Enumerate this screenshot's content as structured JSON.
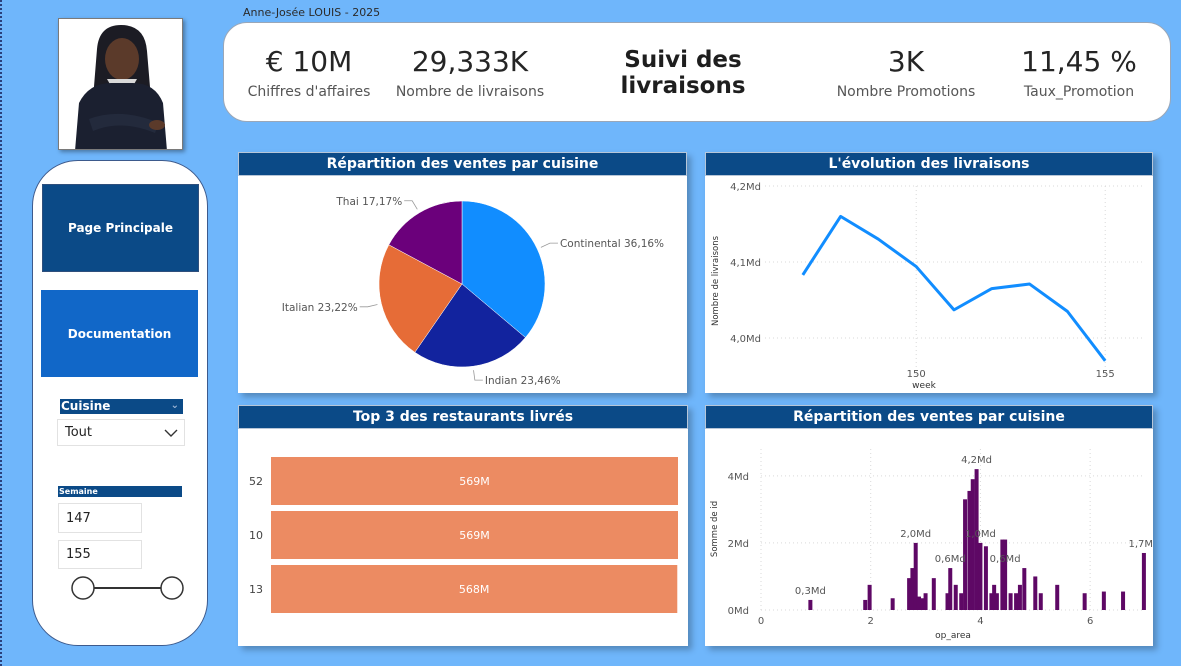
{
  "header": {
    "author": "Anne-Josée LOUIS - 2025",
    "title": "Suivi des livraisons"
  },
  "kpis": [
    {
      "value": "€ 10M",
      "label": "Chiffres d'affaires"
    },
    {
      "value": "29,333K",
      "label": "Nombre de livraisons"
    },
    {
      "value": "3K",
      "label": "Nombre Promotions"
    },
    {
      "value": "11,45 %",
      "label": "Taux_Promotion"
    }
  ],
  "nav": {
    "main_label": "Page Principale",
    "doc_label": "Documentation"
  },
  "filters": {
    "cuisine_label": "Cuisine",
    "cuisine_value": "Tout",
    "semaine_label": "Semaine",
    "semaine_min": "147",
    "semaine_max": "155"
  },
  "colors": {
    "background": "#6fb6fb",
    "title_bar": "#0b4a87",
    "nav_main": "#0b4a87",
    "nav_doc": "#1167c8"
  },
  "chart_data": [
    {
      "type": "pie",
      "title": "Répartition des ventes par cuisine",
      "slices": [
        {
          "label": "Continental",
          "value": 36.16,
          "display": "Continental 36,16%",
          "color": "#118dff"
        },
        {
          "label": "Indian",
          "value": 23.46,
          "display": "Indian 23,46%",
          "color": "#12239e"
        },
        {
          "label": "Italian",
          "value": 23.22,
          "display": "Italian 23,22%",
          "color": "#e66c37"
        },
        {
          "label": "Thai",
          "value": 17.17,
          "display": "Thai 17,17%",
          "color": "#6b007b"
        }
      ]
    },
    {
      "type": "line",
      "title": "L'évolution des livraisons",
      "xlabel": "week",
      "ylabel": "Nombre de livraisons",
      "xlim": [
        146,
        156
      ],
      "ylim": [
        3.95,
        4.2
      ],
      "x": [
        147,
        148,
        149,
        150,
        151,
        152,
        153,
        154,
        155
      ],
      "values": [
        4.083,
        4.16,
        4.13,
        4.094,
        4.037,
        4.065,
        4.071,
        4.035,
        3.97
      ],
      "color": "#118dff",
      "xticks": [
        {
          "v": 150,
          "label": "150"
        },
        {
          "v": 155,
          "label": "155"
        }
      ],
      "yticks": [
        {
          "v": 4.0,
          "label": "4,0Md"
        },
        {
          "v": 4.1,
          "label": "4,1Md"
        },
        {
          "v": 4.2,
          "label": "4,2Md"
        }
      ]
    },
    {
      "type": "bar",
      "orientation": "horizontal",
      "title": "Top 3 des restaurants livrés",
      "categories": [
        "52",
        "10",
        "13"
      ],
      "values": [
        569,
        569,
        568
      ],
      "labels": [
        "569M",
        "569M",
        "568M"
      ],
      "xlim": [
        0,
        569
      ],
      "color": "#ec8b62"
    },
    {
      "type": "bar",
      "title": "Répartition des ventes par cuisine",
      "xlabel": "op_area",
      "ylabel": "Somme de id",
      "xlim": [
        0,
        7
      ],
      "ylim": [
        0,
        4.8
      ],
      "color": "#5e0865",
      "x": [
        0.9,
        1.9,
        1.98,
        2.4,
        2.7,
        2.76,
        2.82,
        2.88,
        2.94,
        3.0,
        3.15,
        3.4,
        3.45,
        3.55,
        3.65,
        3.72,
        3.8,
        3.86,
        3.93,
        4.0,
        4.1,
        4.2,
        4.25,
        4.3,
        4.4,
        4.45,
        4.55,
        4.65,
        4.72,
        4.8,
        5.0,
        5.1,
        5.4,
        5.9,
        6.25,
        6.6,
        6.98
      ],
      "values": [
        0.3,
        0.3,
        0.75,
        0.35,
        0.95,
        1.25,
        2.0,
        0.4,
        0.35,
        0.5,
        0.95,
        0.5,
        1.25,
        0.75,
        0.5,
        3.3,
        3.55,
        3.9,
        4.2,
        2.0,
        1.9,
        0.5,
        0.75,
        0.5,
        2.1,
        2.1,
        0.5,
        0.5,
        0.75,
        1.25,
        1.0,
        0.5,
        0.75,
        0.5,
        0.55,
        0.55,
        1.7
      ],
      "xticks": [
        {
          "v": 0,
          "label": "0"
        },
        {
          "v": 2,
          "label": "2"
        },
        {
          "v": 4,
          "label": "4"
        },
        {
          "v": 6,
          "label": "6"
        }
      ],
      "yticks": [
        {
          "v": 0,
          "label": "0Md"
        },
        {
          "v": 2,
          "label": "2Md"
        },
        {
          "v": 4,
          "label": "4Md"
        }
      ],
      "annotations": [
        {
          "x": 0.9,
          "y": 0.3,
          "label": "0,3Md"
        },
        {
          "x": 2.82,
          "y": 2.0,
          "label": "2,0Md"
        },
        {
          "x": 3.93,
          "y": 4.2,
          "label": "4,2Md"
        },
        {
          "x": 3.45,
          "y": 1.25,
          "label": "0,6Md"
        },
        {
          "x": 4.0,
          "y": 2.0,
          "label": "1,0Md"
        },
        {
          "x": 4.45,
          "y": 1.25,
          "label": "0,6Md"
        },
        {
          "x": 6.98,
          "y": 1.7,
          "label": "1,7Md"
        }
      ]
    }
  ]
}
